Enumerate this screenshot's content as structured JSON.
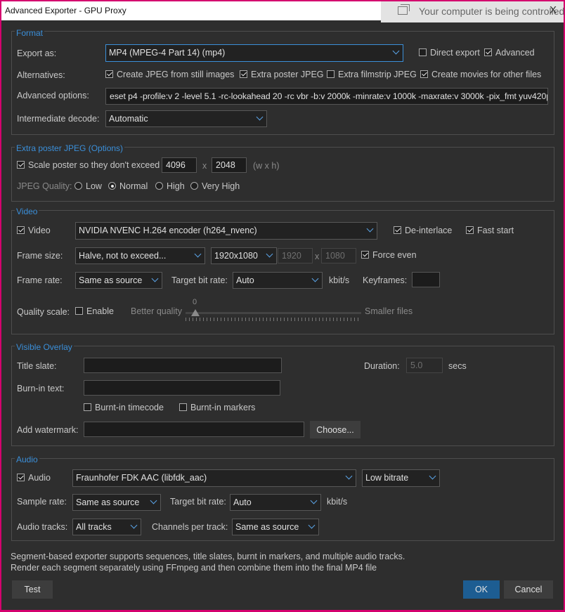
{
  "window": {
    "title": "Advanced Exporter - GPU Proxy"
  },
  "toast": {
    "text": "Your computer is being controlled",
    "close": "X"
  },
  "format": {
    "legend": "Format",
    "export_as_label": "Export as:",
    "export_as_value": "MP4 (MPEG-4 Part 14) (mp4)",
    "direct_export": "Direct export",
    "advanced": "Advanced",
    "alternatives_label": "Alternatives:",
    "alt_jpeg": "Create JPEG from still images",
    "alt_poster": "Extra poster JPEG",
    "alt_filmstrip": "Extra filmstrip JPEG",
    "alt_movies": "Create movies for other files",
    "advanced_options_label": "Advanced options:",
    "advanced_options_value": "eset p4 -profile:v 2 -level 5.1 -rc-lookahead 20 -rc vbr -b:v 2000k -minrate:v 1000k -maxrate:v 3000k -pix_fmt yuv420p",
    "intermediate_label": "Intermediate decode:",
    "intermediate_value": "Automatic"
  },
  "poster": {
    "legend": "Extra poster JPEG (Options)",
    "scale_label": "Scale poster so they don't exceed",
    "width": "4096",
    "x": "x",
    "height": "2048",
    "wxh": "(w x h)",
    "quality_label": "JPEG Quality:",
    "q_low": "Low",
    "q_normal": "Normal",
    "q_high": "High",
    "q_very_high": "Very High"
  },
  "video": {
    "legend": "Video",
    "video_label": "Video",
    "encoder": "NVIDIA NVENC H.264 encoder (h264_nvenc)",
    "deinterlace": "De-interlace",
    "fast_start": "Fast start",
    "frame_size_label": "Frame size:",
    "frame_size_mode": "Halve, not to exceed...",
    "frame_size_value": "1920x1080",
    "fs_w": "1920",
    "fs_x": "x",
    "fs_h": "1080",
    "force_even": "Force even",
    "frame_rate_label": "Frame rate:",
    "frame_rate_value": "Same as source",
    "target_bitrate_label": "Target bit rate:",
    "target_bitrate_value": "Auto",
    "kbits": "kbit/s",
    "keyframes_label": "Keyframes:",
    "keyframes_value": "",
    "quality_scale_label": "Quality scale:",
    "enable": "Enable",
    "better_quality": "Better quality",
    "slider_value": "0",
    "smaller_files": "Smaller files"
  },
  "overlay": {
    "legend": "Visible Overlay",
    "title_slate_label": "Title slate:",
    "title_slate_value": "",
    "duration_label": "Duration:",
    "duration_value": "5.0",
    "secs": "secs",
    "burnin_text_label": "Burn-in text:",
    "burnin_text_value": "",
    "burnin_timecode": "Burnt-in timecode",
    "burnin_markers": "Burnt-in markers",
    "watermark_label": "Add watermark:",
    "watermark_value": "",
    "choose": "Choose..."
  },
  "audio": {
    "legend": "Audio",
    "audio_label": "Audio",
    "codec": "Fraunhofer FDK AAC (libfdk_aac)",
    "profile": "Low bitrate",
    "sample_rate_label": "Sample rate:",
    "sample_rate_value": "Same as source",
    "target_bitrate_label": "Target bit rate:",
    "target_bitrate_value": "Auto",
    "kbits": "kbit/s",
    "tracks_label": "Audio tracks:",
    "tracks_value": "All tracks",
    "channels_label": "Channels per track:",
    "channels_value": "Same as source"
  },
  "footer": {
    "note1": "Segment-based exporter supports sequences, title slates, burnt in markers, and multiple audio tracks.",
    "note2": "Render each segment separately using FFmpeg and then combine them into the final MP4 file",
    "test": "Test",
    "ok": "OK",
    "cancel": "Cancel"
  }
}
